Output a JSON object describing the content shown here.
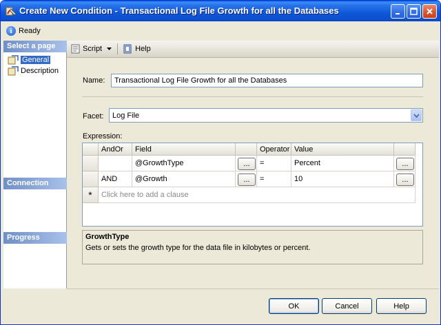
{
  "window": {
    "title": "Create New Condition - Transactional Log File Growth for all the Databases"
  },
  "status": {
    "text": "Ready"
  },
  "left_panel": {
    "select_page_header": "Select a page",
    "pages": [
      {
        "label": "General",
        "selected": true
      },
      {
        "label": "Description",
        "selected": false
      }
    ],
    "connection_header": "Connection",
    "progress_header": "Progress"
  },
  "toolbar": {
    "script_label": "Script",
    "help_label": "Help"
  },
  "form": {
    "name_label": "Name:",
    "name_value": "Transactional Log File Growth for all the Databases",
    "facet_label": "Facet:",
    "facet_value": "Log File",
    "expression_label": "Expression:"
  },
  "grid": {
    "columns": {
      "andor": "AndOr",
      "field": "Field",
      "operator": "Operator",
      "value": "Value"
    },
    "rows": [
      {
        "andor": "",
        "field": "@GrowthType",
        "operator": "=",
        "value": "Percent"
      },
      {
        "andor": "AND",
        "field": "@Growth",
        "operator": "=",
        "value": "10"
      }
    ],
    "new_row_marker": "*",
    "add_clause_text": "Click here to add a clause",
    "ellipsis": "..."
  },
  "description": {
    "title": "GrowthType",
    "text": "Gets or sets the growth type for the data file in kilobytes or percent."
  },
  "buttons": {
    "ok": "OK",
    "cancel": "Cancel",
    "help": "Help"
  }
}
